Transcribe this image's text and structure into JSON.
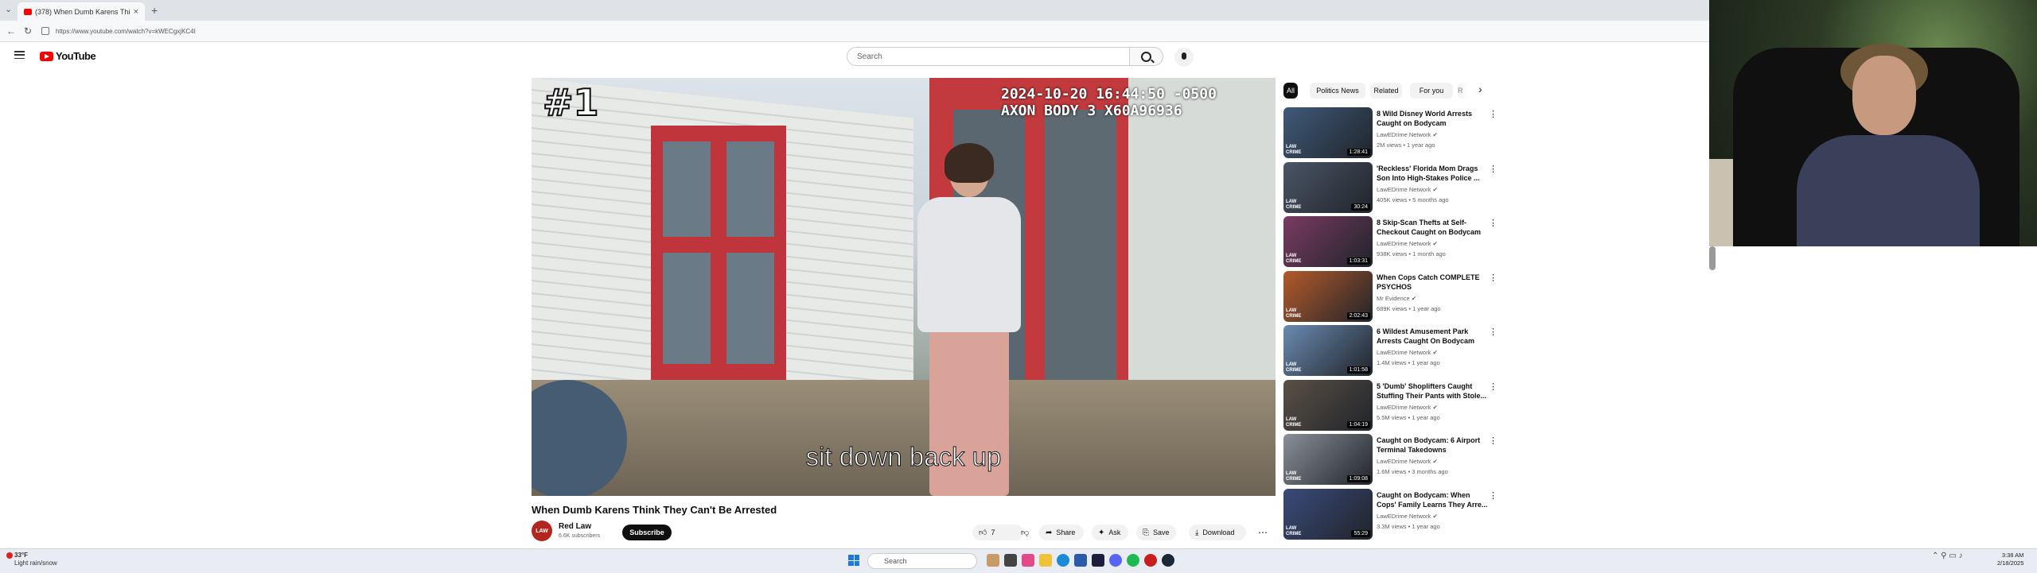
{
  "browser": {
    "tab_title": "(378) When Dumb Karens Thi",
    "url": "https://www.youtube.com/watch?v=kWECgxjKC4I"
  },
  "header": {
    "brand": "YouTube",
    "search_placeholder": "Search"
  },
  "video": {
    "overlay_rank": "#1",
    "timestamp_line1": "2024-10-20 16:44:50 -0500",
    "timestamp_line2": "AXON BODY 3 X60A96936",
    "caption": "sit down back up",
    "title": "When Dumb Karens Think They Can't Be Arrested",
    "channel": "Red Law",
    "subscribers": "6.6K subscribers",
    "subscribe_label": "Subscribe",
    "like_count": "7",
    "share_label": "Share",
    "ask_label": "Ask",
    "save_label": "Save",
    "download_label": "Download"
  },
  "chips": [
    "All",
    "Politics News",
    "Related",
    "For you",
    "R"
  ],
  "recommendations": [
    {
      "title": "8 Wild Disney World Arrests Caught on Bodycam",
      "channel": "LawEDrime Network",
      "meta": "2M views • 1 year ago",
      "duration": "1:28:41",
      "color": "#3f5a7a"
    },
    {
      "title": "'Reckless' Florida Mom Drags Son Into High-Stakes Police ...",
      "channel": "LawEDrime Network",
      "meta": "405K views • 5 months ago",
      "duration": "30:24",
      "color": "#4a5566"
    },
    {
      "title": "8 Skip-Scan Thefts at Self-Checkout Caught on Bodycam",
      "channel": "LawEDrime Network",
      "meta": "938K views • 1 month ago",
      "duration": "1:03:31",
      "color": "#7a3a62"
    },
    {
      "title": "When Cops Catch COMPLETE PSYCHOS",
      "channel": "Mr Evidence",
      "meta": "689K views • 1 year ago",
      "duration": "2:02:43",
      "color": "#b45a2a"
    },
    {
      "title": "6 Wildest Amusement Park Arrests Caught On Bodycam",
      "channel": "LawEDrime Network",
      "meta": "1.4M views • 1 year ago",
      "duration": "1:01:58",
      "color": "#6a8ab0"
    },
    {
      "title": "5 'Dumb' Shoplifters Caught Stuffing Their Pants with Stole...",
      "channel": "LawEDrime Network",
      "meta": "5.5M views • 1 year ago",
      "duration": "1:04:19",
      "color": "#5a5046"
    },
    {
      "title": "Caught on Bodycam: 6 Airport Terminal Takedowns",
      "channel": "LawEDrime Network",
      "meta": "1.6M views • 3 months ago",
      "duration": "1:09:08",
      "color": "#8a9098"
    },
    {
      "title": "Caught on Bodycam: When Cops' Family Learns They Arre...",
      "channel": "LawEDrime Network",
      "meta": "3.3M views • 1 year ago",
      "duration": "55:29",
      "color": "#3a4a7a"
    }
  ],
  "rec_brand": "LAW\nCRIME",
  "taskbar": {
    "weather_temp": "33°F",
    "weather_desc": "Light rain/snow",
    "search_label": "Search",
    "time": "3:38 AM",
    "date": "2/18/2025"
  }
}
